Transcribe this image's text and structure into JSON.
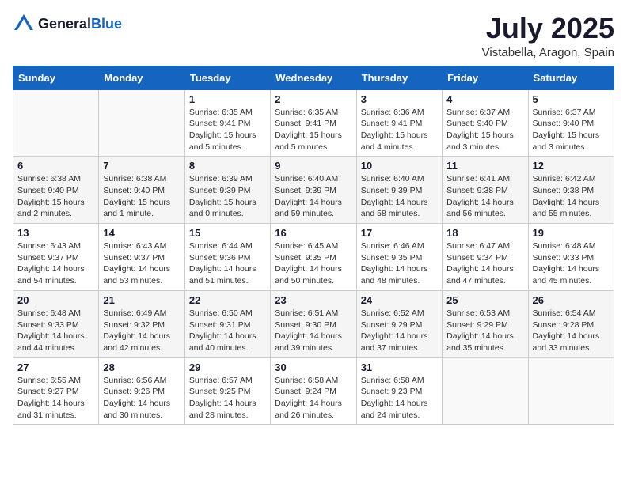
{
  "header": {
    "logo_general": "General",
    "logo_blue": "Blue",
    "month_year": "July 2025",
    "location": "Vistabella, Aragon, Spain"
  },
  "weekdays": [
    "Sunday",
    "Monday",
    "Tuesday",
    "Wednesday",
    "Thursday",
    "Friday",
    "Saturday"
  ],
  "weeks": [
    [
      {
        "day": "",
        "info": ""
      },
      {
        "day": "",
        "info": ""
      },
      {
        "day": "1",
        "info": "Sunrise: 6:35 AM\nSunset: 9:41 PM\nDaylight: 15 hours and 5 minutes."
      },
      {
        "day": "2",
        "info": "Sunrise: 6:35 AM\nSunset: 9:41 PM\nDaylight: 15 hours and 5 minutes."
      },
      {
        "day": "3",
        "info": "Sunrise: 6:36 AM\nSunset: 9:41 PM\nDaylight: 15 hours and 4 minutes."
      },
      {
        "day": "4",
        "info": "Sunrise: 6:37 AM\nSunset: 9:40 PM\nDaylight: 15 hours and 3 minutes."
      },
      {
        "day": "5",
        "info": "Sunrise: 6:37 AM\nSunset: 9:40 PM\nDaylight: 15 hours and 3 minutes."
      }
    ],
    [
      {
        "day": "6",
        "info": "Sunrise: 6:38 AM\nSunset: 9:40 PM\nDaylight: 15 hours and 2 minutes."
      },
      {
        "day": "7",
        "info": "Sunrise: 6:38 AM\nSunset: 9:40 PM\nDaylight: 15 hours and 1 minute."
      },
      {
        "day": "8",
        "info": "Sunrise: 6:39 AM\nSunset: 9:39 PM\nDaylight: 15 hours and 0 minutes."
      },
      {
        "day": "9",
        "info": "Sunrise: 6:40 AM\nSunset: 9:39 PM\nDaylight: 14 hours and 59 minutes."
      },
      {
        "day": "10",
        "info": "Sunrise: 6:40 AM\nSunset: 9:39 PM\nDaylight: 14 hours and 58 minutes."
      },
      {
        "day": "11",
        "info": "Sunrise: 6:41 AM\nSunset: 9:38 PM\nDaylight: 14 hours and 56 minutes."
      },
      {
        "day": "12",
        "info": "Sunrise: 6:42 AM\nSunset: 9:38 PM\nDaylight: 14 hours and 55 minutes."
      }
    ],
    [
      {
        "day": "13",
        "info": "Sunrise: 6:43 AM\nSunset: 9:37 PM\nDaylight: 14 hours and 54 minutes."
      },
      {
        "day": "14",
        "info": "Sunrise: 6:43 AM\nSunset: 9:37 PM\nDaylight: 14 hours and 53 minutes."
      },
      {
        "day": "15",
        "info": "Sunrise: 6:44 AM\nSunset: 9:36 PM\nDaylight: 14 hours and 51 minutes."
      },
      {
        "day": "16",
        "info": "Sunrise: 6:45 AM\nSunset: 9:35 PM\nDaylight: 14 hours and 50 minutes."
      },
      {
        "day": "17",
        "info": "Sunrise: 6:46 AM\nSunset: 9:35 PM\nDaylight: 14 hours and 48 minutes."
      },
      {
        "day": "18",
        "info": "Sunrise: 6:47 AM\nSunset: 9:34 PM\nDaylight: 14 hours and 47 minutes."
      },
      {
        "day": "19",
        "info": "Sunrise: 6:48 AM\nSunset: 9:33 PM\nDaylight: 14 hours and 45 minutes."
      }
    ],
    [
      {
        "day": "20",
        "info": "Sunrise: 6:48 AM\nSunset: 9:33 PM\nDaylight: 14 hours and 44 minutes."
      },
      {
        "day": "21",
        "info": "Sunrise: 6:49 AM\nSunset: 9:32 PM\nDaylight: 14 hours and 42 minutes."
      },
      {
        "day": "22",
        "info": "Sunrise: 6:50 AM\nSunset: 9:31 PM\nDaylight: 14 hours and 40 minutes."
      },
      {
        "day": "23",
        "info": "Sunrise: 6:51 AM\nSunset: 9:30 PM\nDaylight: 14 hours and 39 minutes."
      },
      {
        "day": "24",
        "info": "Sunrise: 6:52 AM\nSunset: 9:29 PM\nDaylight: 14 hours and 37 minutes."
      },
      {
        "day": "25",
        "info": "Sunrise: 6:53 AM\nSunset: 9:29 PM\nDaylight: 14 hours and 35 minutes."
      },
      {
        "day": "26",
        "info": "Sunrise: 6:54 AM\nSunset: 9:28 PM\nDaylight: 14 hours and 33 minutes."
      }
    ],
    [
      {
        "day": "27",
        "info": "Sunrise: 6:55 AM\nSunset: 9:27 PM\nDaylight: 14 hours and 31 minutes."
      },
      {
        "day": "28",
        "info": "Sunrise: 6:56 AM\nSunset: 9:26 PM\nDaylight: 14 hours and 30 minutes."
      },
      {
        "day": "29",
        "info": "Sunrise: 6:57 AM\nSunset: 9:25 PM\nDaylight: 14 hours and 28 minutes."
      },
      {
        "day": "30",
        "info": "Sunrise: 6:58 AM\nSunset: 9:24 PM\nDaylight: 14 hours and 26 minutes."
      },
      {
        "day": "31",
        "info": "Sunrise: 6:58 AM\nSunset: 9:23 PM\nDaylight: 14 hours and 24 minutes."
      },
      {
        "day": "",
        "info": ""
      },
      {
        "day": "",
        "info": ""
      }
    ]
  ]
}
